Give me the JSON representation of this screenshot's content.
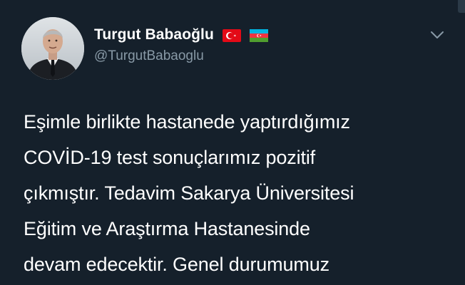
{
  "colors": {
    "background": "#15202b",
    "text_primary": "#ffffff",
    "text_secondary": "#8899a6"
  },
  "user": {
    "display_name": "Turgut Babaoğlu",
    "handle": "@TurgutBabaoglu",
    "avatar_icon": "profile-photo",
    "flags": [
      "turkey-flag-icon",
      "azerbaijan-flag-icon"
    ]
  },
  "menu": {
    "icon": "chevron-down-icon"
  },
  "tweet": {
    "lines": [
      "Eşimle birlikte hastanede yaptırdığımız",
      "COVİD-19 test sonuçlarımız pozitif",
      "çıkmıştır. Tedavim Sakarya Üniversitesi",
      "Eğitim ve Araştırma Hastanesinde",
      "devam edecektir. Genel durumumuz"
    ]
  }
}
